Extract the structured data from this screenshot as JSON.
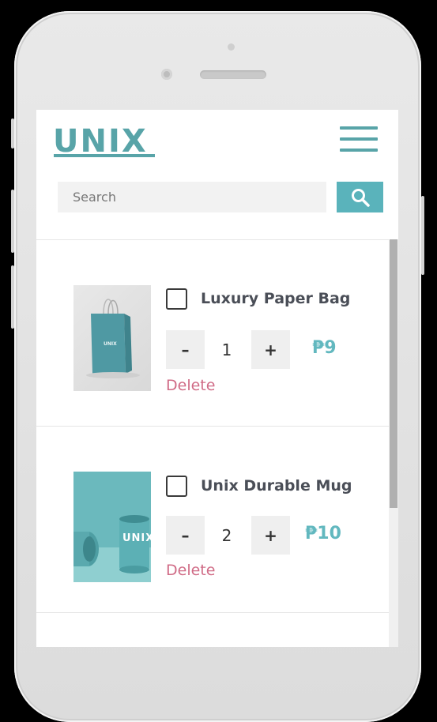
{
  "header": {
    "logo_text": "UNIX",
    "search": {
      "placeholder": "Search",
      "value": ""
    }
  },
  "cart": {
    "items": [
      {
        "name": "Luxury Paper Bag",
        "quantity": "1",
        "price": "₱9",
        "minus_label": "–",
        "plus_label": "+",
        "delete_label": "Delete",
        "checked": false
      },
      {
        "name": "Unix Durable Mug",
        "quantity": "2",
        "price": "₱10",
        "minus_label": "–",
        "plus_label": "+",
        "delete_label": "Delete",
        "checked": false
      }
    ],
    "mug_logo_text": "UNIX",
    "bag_logo_text": "UNIX"
  },
  "colors": {
    "accent": "#58a4a8",
    "search_button": "#5ab3bb",
    "price": "#62b8bf",
    "delete": "#d06b86"
  },
  "icons": {
    "menu": "hamburger-icon",
    "search": "search-icon"
  }
}
